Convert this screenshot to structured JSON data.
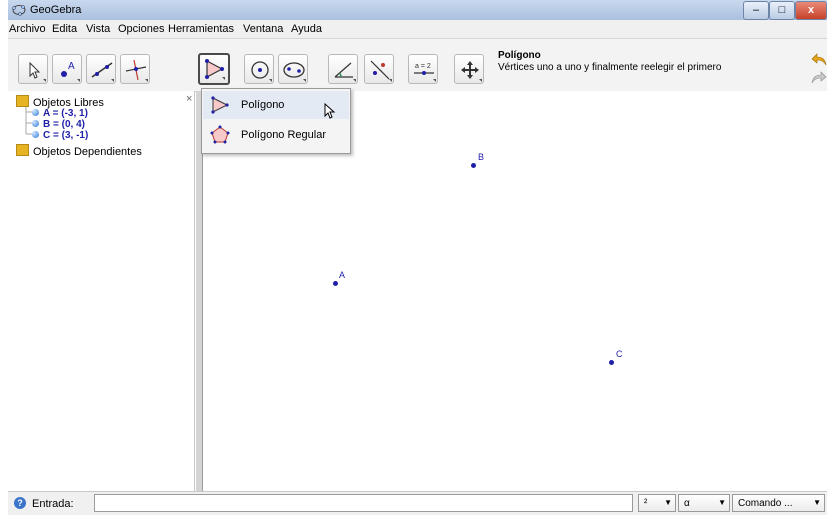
{
  "window": {
    "title": "GeoGebra",
    "minimize": "–",
    "maximize": "□",
    "close": "x"
  },
  "menubar": {
    "items": [
      "Archivo",
      "Edita",
      "Vista",
      "Opciones",
      "Herramientas",
      "Ventana",
      "Ayuda"
    ]
  },
  "toolbar": {
    "tools": [
      {
        "name": "move-tool",
        "icon": "arrow-cursor-icon"
      },
      {
        "name": "point-tool",
        "icon": "point-icon",
        "label": "A"
      },
      {
        "name": "line-tool",
        "icon": "line-icon"
      },
      {
        "name": "perpendicular-tool",
        "icon": "perpendicular-icon"
      },
      {
        "name": "polygon-tool",
        "icon": "polygon-icon",
        "active": true
      },
      {
        "name": "circle-tool",
        "icon": "circle-icon"
      },
      {
        "name": "conic-tool",
        "icon": "ellipse-icon"
      },
      {
        "name": "angle-tool",
        "icon": "angle-icon"
      },
      {
        "name": "reflect-tool",
        "icon": "reflect-icon"
      },
      {
        "name": "slider-tool",
        "icon": "slider-icon",
        "label": "a = 2"
      },
      {
        "name": "move-view-tool",
        "icon": "move-view-icon"
      }
    ],
    "tooltip_title": "Polígono",
    "tooltip_desc": "Vértices uno a uno y finalmente reelegir el primero"
  },
  "algebra": {
    "free_folder": "Objetos Libres",
    "objects": [
      "A = (-3, 1)",
      "B = (0, 4)",
      "C = (3, -1)"
    ],
    "dependent_folder": "Objetos Dependientes",
    "close_glyph": "×"
  },
  "dropdown": {
    "items": [
      {
        "label": "Polígono",
        "icon": "polygon-icon",
        "hover": true
      },
      {
        "label": "Polígono Regular",
        "icon": "regular-polygon-icon"
      }
    ]
  },
  "graphics": {
    "points": [
      {
        "label": "A",
        "x": -3,
        "y": 1
      },
      {
        "label": "B",
        "x": 0,
        "y": 4
      },
      {
        "label": "C",
        "x": 3,
        "y": -1
      }
    ]
  },
  "inputbar": {
    "label": "Entrada:",
    "value": "",
    "symbol_select": "²",
    "greek_select": "α",
    "command_select": "Comando ..."
  },
  "colors": {
    "point": "#1f1fa8",
    "titlebar": "#b9cde8",
    "close_button": "#c6412a"
  }
}
